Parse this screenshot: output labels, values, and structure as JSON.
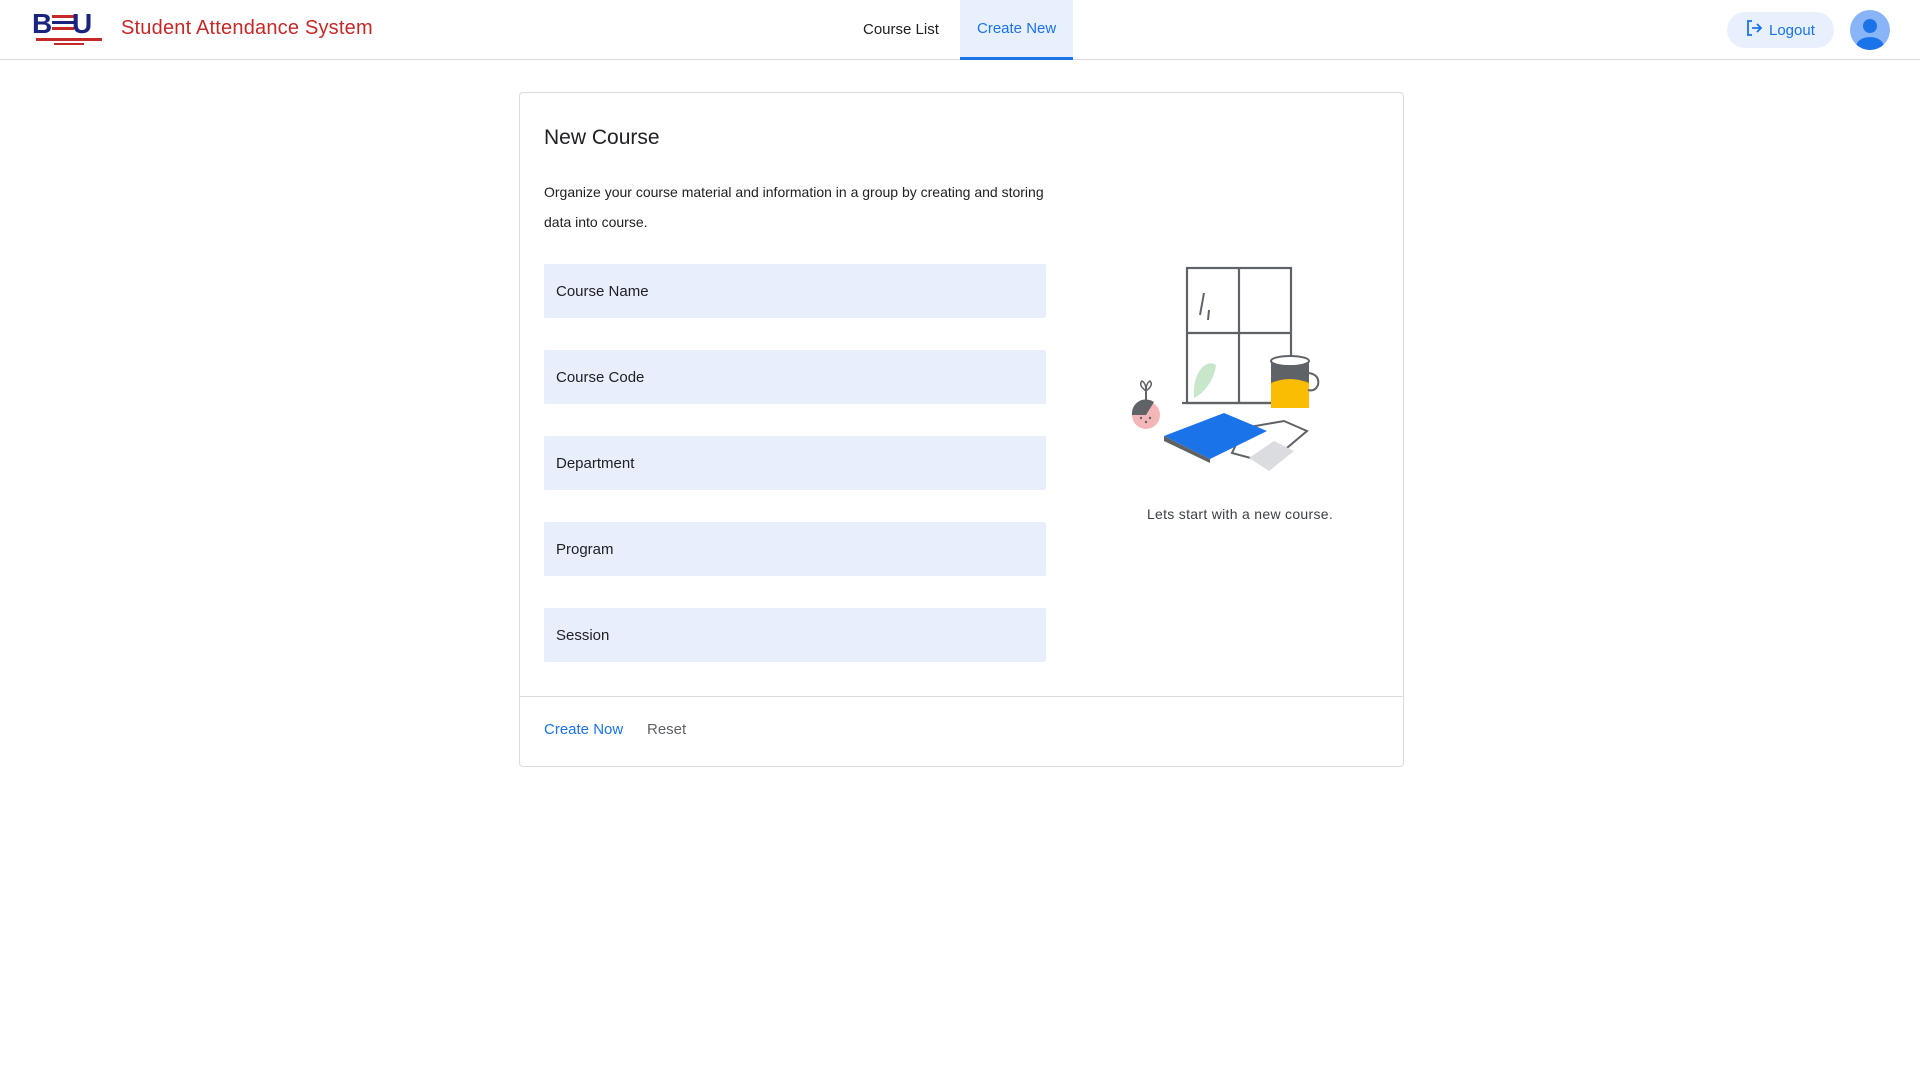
{
  "header": {
    "logo_text": "BDU",
    "app_title": "Student Attendance System",
    "nav": [
      {
        "label": "Course List",
        "active": false
      },
      {
        "label": "Create New",
        "active": true
      }
    ],
    "logout_label": "Logout",
    "logout_icon": "logout-icon",
    "avatar_icon": "user-avatar-icon"
  },
  "card": {
    "title": "New Course",
    "description": "Organize your course material and information in a group by creating and storing data into course.",
    "fields": {
      "course_name": {
        "placeholder": "Course Name",
        "value": ""
      },
      "course_code": {
        "placeholder": "Course Code",
        "value": ""
      },
      "department": {
        "placeholder": "Department",
        "value": ""
      },
      "program": {
        "placeholder": "Program",
        "value": ""
      },
      "session": {
        "placeholder": "Session",
        "value": ""
      }
    },
    "illustration_caption": "Lets start with a new course.",
    "create_label": "Create Now",
    "reset_label": "Reset"
  },
  "colors": {
    "accent": "#1a73e8",
    "brand_red": "#c62828",
    "field_bg": "#e8eefc",
    "active_tab_bg": "#e8f0fe"
  }
}
